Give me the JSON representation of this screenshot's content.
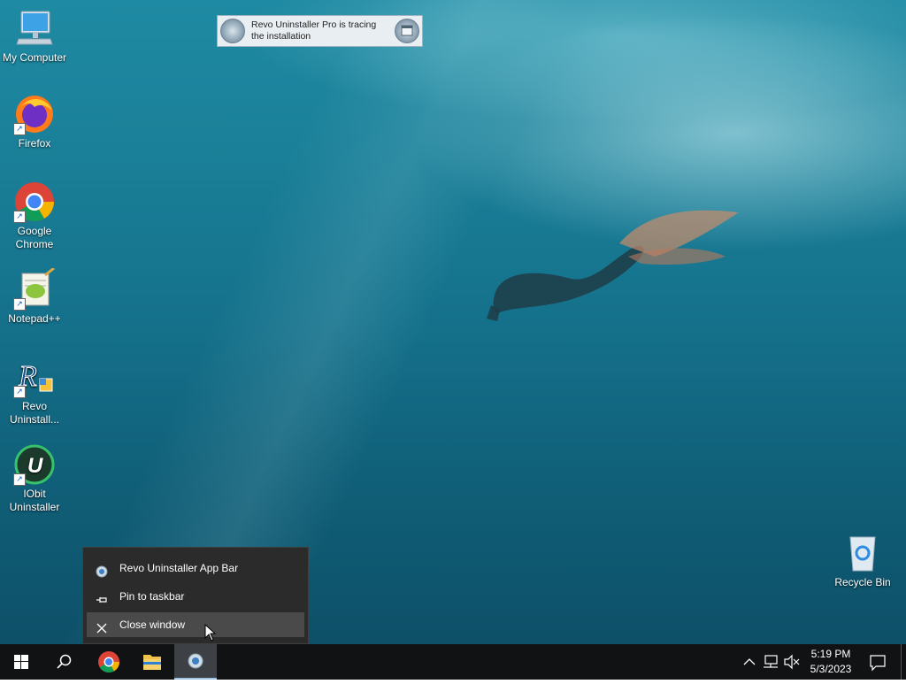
{
  "desktop_icons": [
    {
      "label": "My Computer",
      "icon": "computer-icon"
    },
    {
      "label": "Firefox",
      "icon": "firefox-icon"
    },
    {
      "label": "Google Chrome",
      "icon": "chrome-icon"
    },
    {
      "label": "Notepad++",
      "icon": "notepadpp-icon"
    },
    {
      "label": "Revo Uninstall...",
      "icon": "revo-uninstaller-icon"
    },
    {
      "label": "IObit Uninstaller",
      "icon": "iobit-uninstaller-icon"
    }
  ],
  "recycle_bin": {
    "label": "Recycle Bin",
    "icon": "recycle-bin-icon"
  },
  "tracer_bar": {
    "text": "Revo Uninstaller Pro is tracing the installation"
  },
  "context_menu": {
    "items": [
      {
        "label": "Revo Uninstaller App Bar",
        "icon": "revo-app-bar-icon"
      },
      {
        "label": "Pin to taskbar",
        "icon": "pin-icon"
      },
      {
        "label": "Close window",
        "icon": "close-icon"
      }
    ],
    "hovered_index": 2
  },
  "taskbar": {
    "apps": [
      "start",
      "search",
      "chrome",
      "file-explorer",
      "revo-app-bar"
    ],
    "active_app": "revo-app-bar",
    "clock": {
      "time": "5:19 PM",
      "date": "5/3/2023"
    }
  },
  "colors": {
    "taskbar": "#101214",
    "menu_bg": "#2b2b2b",
    "menu_hover": "#4a4a4a",
    "accent": "#0078d7"
  }
}
